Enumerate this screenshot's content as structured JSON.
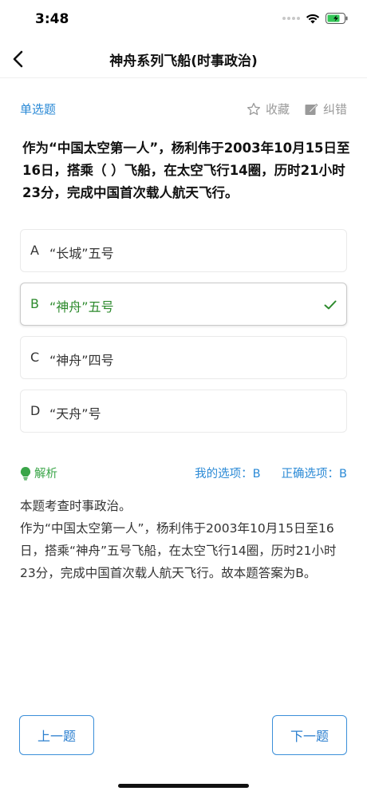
{
  "status": {
    "time": "3:48"
  },
  "nav": {
    "title": "神舟系列飞船(时事政治)"
  },
  "question": {
    "type": "单选题",
    "favorite_label": "收藏",
    "correct_label": "纠错",
    "text": "作为“中国太空第一人”，杨利伟于2003年10月15日至16日，搭乘（ ）飞船，在太空飞行14圈，历时21小时23分，完成中国首次载人航天飞行。"
  },
  "options": [
    {
      "letter": "A",
      "text": "“长城”五号"
    },
    {
      "letter": "B",
      "text": "“神舟”五号"
    },
    {
      "letter": "C",
      "text": "“神舟”四号"
    },
    {
      "letter": "D",
      "text": "“天舟”号"
    }
  ],
  "analysis": {
    "label": "解析",
    "my_answer": "我的选项：B",
    "correct_answer": "正确选项：B",
    "line1": "本题考查时事政治。",
    "line2": "作为“中国太空第一人”，杨利伟于2003年10月15日至16日，搭乘“神舟”五号飞船，在太空飞行14圈，历时21小时23分，完成中国首次载人航天飞行。故本题答案为B。"
  },
  "buttons": {
    "prev": "上一题",
    "next": "下一题"
  },
  "colors": {
    "accent": "#2b8ad6",
    "correct": "#2e8b2e",
    "analysis": "#3aa548"
  }
}
